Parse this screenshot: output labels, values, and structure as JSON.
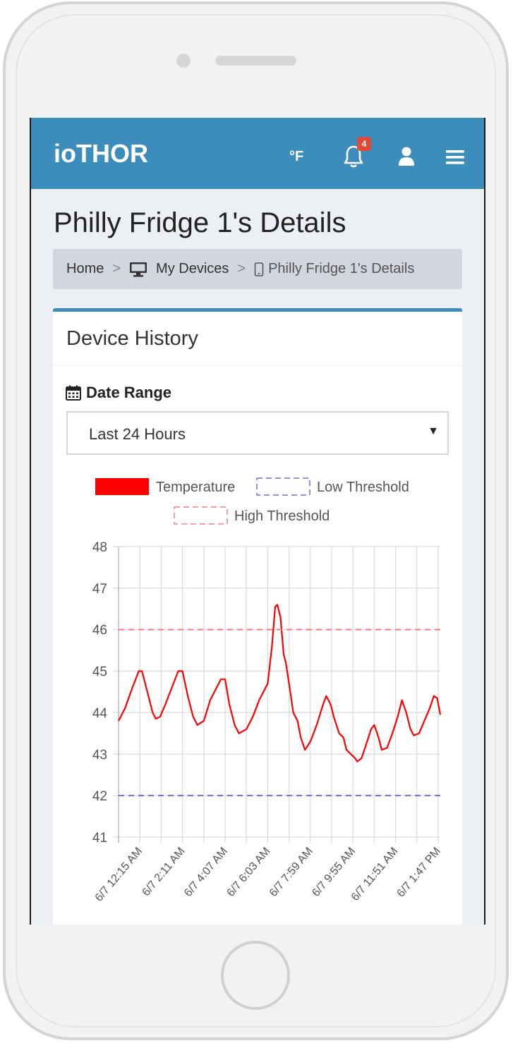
{
  "app": {
    "logo": "ioTHOR",
    "unit_toggle": "°F",
    "notification_count": "4",
    "accent_color": "#3c8dbc"
  },
  "page": {
    "title": "Philly Fridge 1's Details"
  },
  "breadcrumb": {
    "home": "Home",
    "separator": ">",
    "my_devices": "My Devices",
    "current": "Philly Fridge 1's Details"
  },
  "card": {
    "title": "Device History",
    "date_range_label": "Date Range",
    "date_range_value": "Last 24 Hours"
  },
  "icons": {
    "nav": [
      "bell-icon",
      "user-icon",
      "menu-icon"
    ],
    "breadcrumb": [
      "monitor-icon",
      "mobile-icon"
    ],
    "date": "calendar-icon"
  },
  "chart_data": {
    "type": "line",
    "legend": [
      "Temperature",
      "Low Threshold",
      "High Threshold"
    ],
    "legend_position": "top",
    "ylim": [
      41,
      48
    ],
    "yticks": [
      41,
      42,
      43,
      44,
      45,
      46,
      47,
      48
    ],
    "grid": true,
    "x_tick_labels": [
      "6/7 12:15 AM",
      "6/7 2:11 AM",
      "6/7 4:07 AM",
      "6/7 6:03 AM",
      "6/7 7:59 AM",
      "6/7 9:55 AM",
      "6/7 11:51 AM",
      "6/7 1:47 PM"
    ],
    "series": [
      {
        "name": "Temperature",
        "color": "#ff0000",
        "points": [
          [
            0,
            43.8
          ],
          [
            0.3,
            44.1
          ],
          [
            0.65,
            44.6
          ],
          [
            0.95,
            45.0
          ],
          [
            1.1,
            45.0
          ],
          [
            1.35,
            44.5
          ],
          [
            1.6,
            44.0
          ],
          [
            1.75,
            43.85
          ],
          [
            1.95,
            43.9
          ],
          [
            2.2,
            44.2
          ],
          [
            2.5,
            44.6
          ],
          [
            2.8,
            45.0
          ],
          [
            3.0,
            45.0
          ],
          [
            3.25,
            44.4
          ],
          [
            3.5,
            43.9
          ],
          [
            3.7,
            43.7
          ],
          [
            4.0,
            43.8
          ],
          [
            4.3,
            44.3
          ],
          [
            4.6,
            44.6
          ],
          [
            4.8,
            44.8
          ],
          [
            5.0,
            44.8
          ],
          [
            5.2,
            44.2
          ],
          [
            5.45,
            43.7
          ],
          [
            5.65,
            43.5
          ],
          [
            6.0,
            43.6
          ],
          [
            6.3,
            43.9
          ],
          [
            6.6,
            44.3
          ],
          [
            6.9,
            44.6
          ],
          [
            7.0,
            44.7
          ],
          [
            7.2,
            45.6
          ],
          [
            7.35,
            46.55
          ],
          [
            7.45,
            46.6
          ],
          [
            7.6,
            46.3
          ],
          [
            7.75,
            45.4
          ],
          [
            7.85,
            45.2
          ],
          [
            8.0,
            44.7
          ],
          [
            8.2,
            44.0
          ],
          [
            8.4,
            43.8
          ],
          [
            8.55,
            43.4
          ],
          [
            8.75,
            43.1
          ],
          [
            9.0,
            43.3
          ],
          [
            9.3,
            43.7
          ],
          [
            9.6,
            44.2
          ],
          [
            9.75,
            44.4
          ],
          [
            9.95,
            44.2
          ],
          [
            10.1,
            43.9
          ],
          [
            10.35,
            43.5
          ],
          [
            10.55,
            43.4
          ],
          [
            10.7,
            43.1
          ],
          [
            10.9,
            43.0
          ],
          [
            11.1,
            42.9
          ],
          [
            11.2,
            42.82
          ],
          [
            11.4,
            42.9
          ],
          [
            11.6,
            43.2
          ],
          [
            11.85,
            43.6
          ],
          [
            12.0,
            43.7
          ],
          [
            12.2,
            43.4
          ],
          [
            12.35,
            43.1
          ],
          [
            12.6,
            43.15
          ],
          [
            12.85,
            43.5
          ],
          [
            13.1,
            43.9
          ],
          [
            13.3,
            44.3
          ],
          [
            13.5,
            44.0
          ],
          [
            13.7,
            43.6
          ],
          [
            13.85,
            43.45
          ],
          [
            14.1,
            43.5
          ],
          [
            14.35,
            43.8
          ],
          [
            14.6,
            44.1
          ],
          [
            14.8,
            44.4
          ],
          [
            14.95,
            44.35
          ],
          [
            15.1,
            43.95
          ]
        ]
      },
      {
        "name": "Low Threshold",
        "value": 42,
        "color": "#6b6bef",
        "style": "dashed"
      },
      {
        "name": "High Threshold",
        "value": 46,
        "color": "#f08080",
        "style": "dashed"
      }
    ]
  }
}
